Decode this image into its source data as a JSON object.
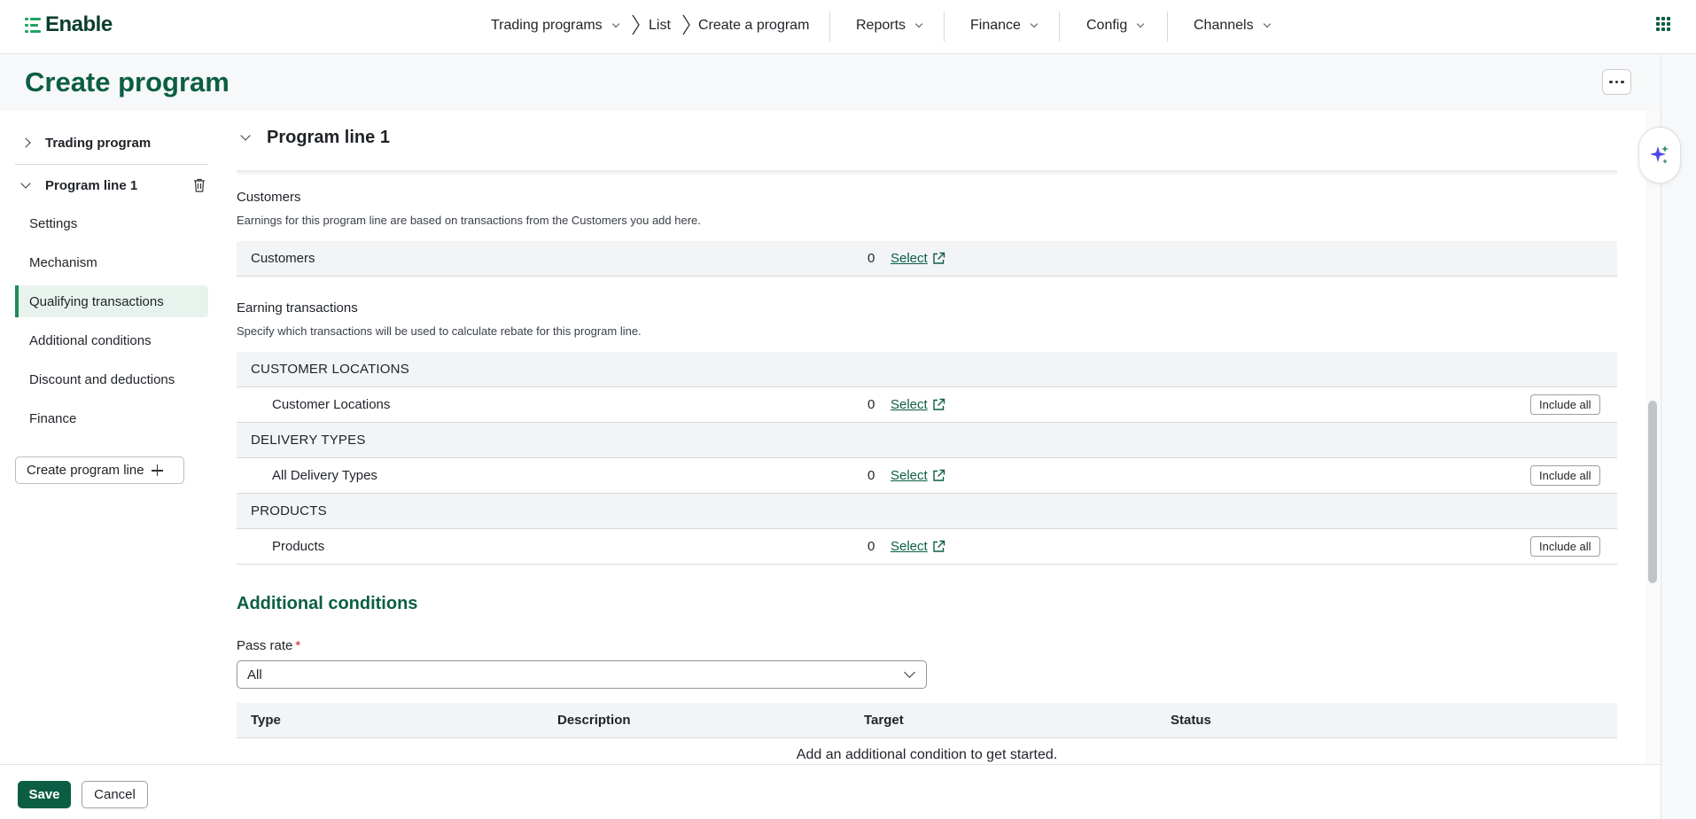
{
  "app": {
    "logo_text": "Enable"
  },
  "topnav": {
    "trading_programs": "Trading programs",
    "breadcrumb_list": "List",
    "breadcrumb_current": "Create a program",
    "reports": "Reports",
    "finance": "Finance",
    "config": "Config",
    "channels": "Channels"
  },
  "page": {
    "title": "Create program"
  },
  "sidebar": {
    "trading_program": "Trading program",
    "program_line": "Program line 1",
    "items": [
      {
        "label": "Settings"
      },
      {
        "label": "Mechanism"
      },
      {
        "label": "Qualifying transactions",
        "active": true
      },
      {
        "label": "Additional conditions"
      },
      {
        "label": "Discount and deductions"
      },
      {
        "label": "Finance"
      }
    ],
    "create_line_button": "Create program line"
  },
  "main": {
    "section_title": "Program line 1",
    "customers": {
      "title": "Customers",
      "description": "Earnings for this program line are based on transactions from the Customers you add here.",
      "row_label": "Customers",
      "count": "0",
      "select_label": "Select"
    },
    "earning": {
      "title": "Earning transactions",
      "description": "Specify which transactions will be used to calculate rebate for this program line.",
      "groups": [
        {
          "header": "CUSTOMER LOCATIONS",
          "label": "Customer Locations",
          "count": "0",
          "select_label": "Select",
          "include_label": "Include all"
        },
        {
          "header": "DELIVERY TYPES",
          "label": "All Delivery Types",
          "count": "0",
          "select_label": "Select",
          "include_label": "Include all"
        },
        {
          "header": "PRODUCTS",
          "label": "Products",
          "count": "0",
          "select_label": "Select",
          "include_label": "Include all"
        }
      ]
    },
    "additional_conditions": {
      "title": "Additional conditions",
      "pass_rate_label": "Pass rate",
      "required_mark": "*",
      "pass_rate_value": "All",
      "columns": [
        "Type",
        "Description",
        "Target",
        "Status"
      ],
      "empty_message": "Add an additional condition to get started."
    }
  },
  "footer": {
    "save": "Save",
    "cancel": "Cancel"
  },
  "colors": {
    "brand": "#0b5e44",
    "accent_green": "#1fa463",
    "active_bg": "#e9f3ee",
    "ai_icon": "#4f46e5"
  }
}
